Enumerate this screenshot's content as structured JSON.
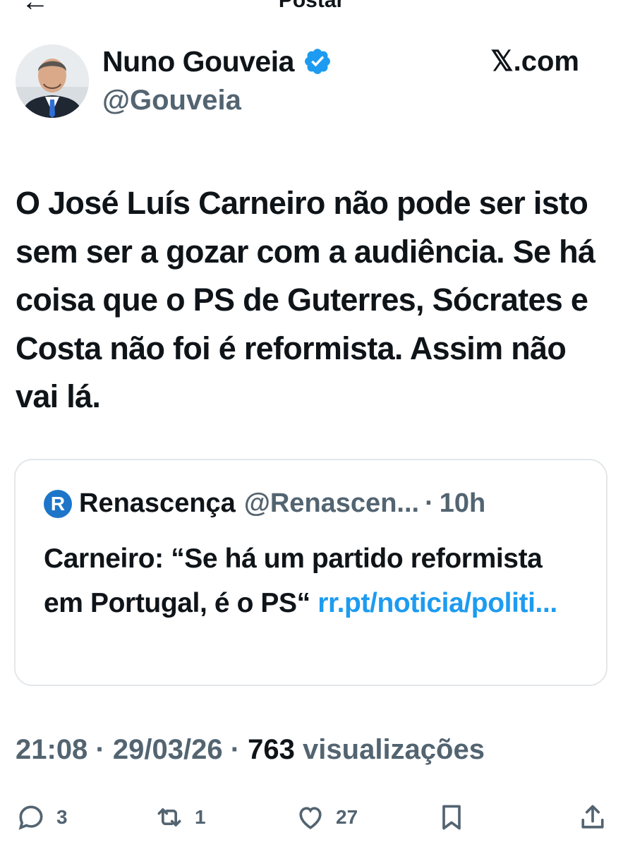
{
  "topbar": {
    "title": "Postar"
  },
  "author": {
    "name": "Nuno Gouveia",
    "handle": "@Gouveia",
    "verified": true,
    "source_label": "𝕏.com"
  },
  "tweet": {
    "text": "O José Luís Carneiro não pode ser isto sem ser a gozar com a audiência. Se há coisa que o PS de Guterres, Sócrates e Costa não foi é reformista. Assim não vai lá."
  },
  "quote": {
    "logo_letter": "R",
    "name": "Renascença",
    "handle": "@Renascen...",
    "separator": "·",
    "time": "10h",
    "text": "Carneiro: “Se há um partido reformista em Portugal, é o PS“",
    "link": "rr.pt/noticia/politi..."
  },
  "meta": {
    "time": "21:08",
    "separator": "·",
    "date": "29/03/26",
    "views": "763",
    "views_label": "visualizações"
  },
  "actions": {
    "replies": "3",
    "reposts": "1",
    "likes": "27"
  },
  "colors": {
    "accent": "#1d9bf0",
    "text": "#0f1419",
    "muted": "#536471",
    "border": "#e3e7ea"
  },
  "icons": [
    "back-arrow-icon",
    "more-icon",
    "verified-icon",
    "reply-icon",
    "repost-icon",
    "like-icon",
    "bookmark-icon",
    "share-icon"
  ]
}
